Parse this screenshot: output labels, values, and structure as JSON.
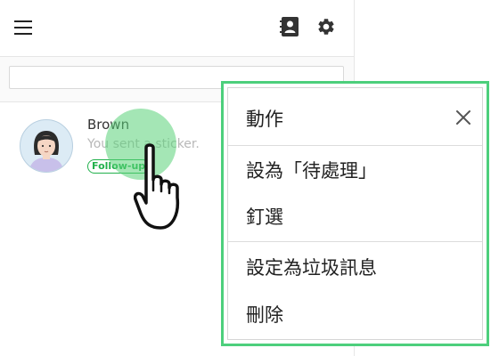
{
  "header": {
    "icons": [
      "menu-icon",
      "contacts-icon",
      "gear-icon"
    ]
  },
  "search": {
    "value": "",
    "placeholder": ""
  },
  "chat_list": [
    {
      "name": "Brown",
      "preview": "You sent a sticker.",
      "badge": "Follow-up",
      "badge_color": "#22b14c"
    }
  ],
  "context_menu": {
    "title": "動作",
    "close_icon": "close-icon",
    "highlight_color": "#4dcf7c",
    "items": [
      {
        "label": "設為「待處理」"
      },
      {
        "label": "釘選"
      },
      {
        "label": "設定為垃圾訊息"
      },
      {
        "label": "刪除"
      }
    ]
  },
  "touch_indicator": {
    "icon": "hand-pointer-icon",
    "color": "#5ad278"
  }
}
